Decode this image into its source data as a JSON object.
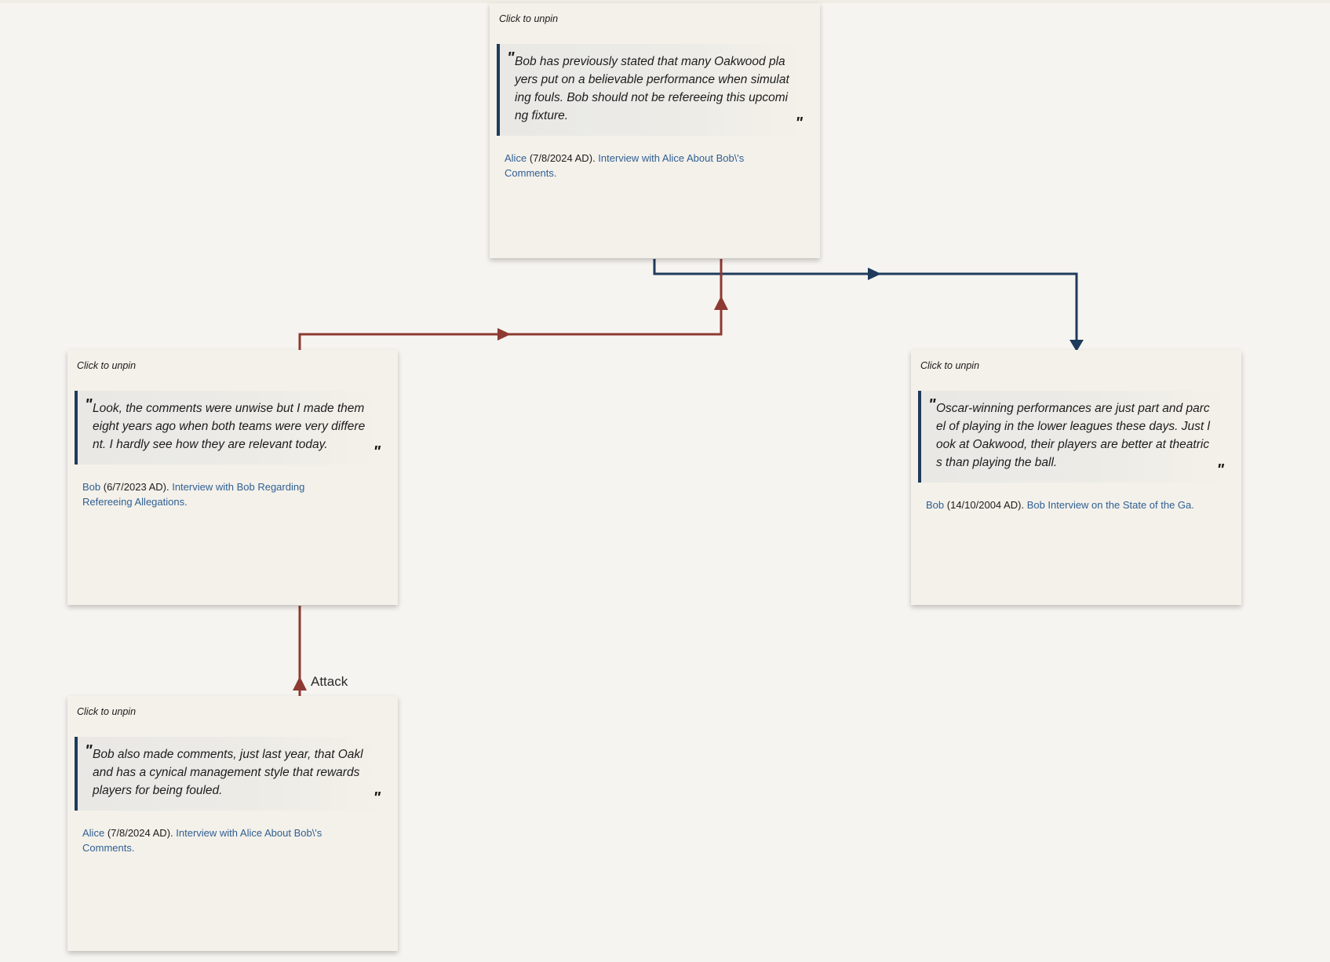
{
  "colors": {
    "support_edge": "#1f3b5c",
    "attack_edge": "#8e3a32",
    "card_background": "#f4f1ea",
    "link": "#2f5f93"
  },
  "cards": {
    "alice_top": {
      "unpin_label": "Click to unpin",
      "open_quote": "\"",
      "close_quote": "\"",
      "quote_text": "Bob has previously stated that many Oakwood players put on a believable performance when simulating fouls. Bob should not be refereeing this upcoming fixture.",
      "author": "Alice",
      "date": "(7/8/2024 AD).",
      "source": "Interview with Alice About Bob\\'s Comments."
    },
    "bob_left": {
      "unpin_label": "Click to unpin",
      "open_quote": "\"",
      "close_quote": "\"",
      "quote_text": "Look, the comments were unwise but I made them eight years ago when both teams were very different. I hardly see how they are relevant today.",
      "author": "Bob",
      "date": "(6/7/2023 AD).",
      "source": "Interview with Bob Regarding Refereeing Allegations."
    },
    "bob_right": {
      "unpin_label": "Click to unpin",
      "open_quote": "\"",
      "close_quote": "\"",
      "quote_text": "Oscar-winning performances are just part and parcel of playing in the lower leagues these days. Just look at Oakwood, their players are better at theatrics than playing the ball.",
      "author": "Bob",
      "date": "(14/10/2004 AD).",
      "source": "Bob Interview on the State of the Ga."
    },
    "alice_bottom": {
      "unpin_label": "Click to unpin",
      "open_quote": "\"",
      "close_quote": "\"",
      "quote_text": "Bob also made comments, just last year, that Oakland has a cynical management style that rewards players for being fouled.",
      "author": "Alice",
      "date": "(7/8/2024 AD).",
      "source": "Interview with Alice About Bob\\'s Comments."
    }
  },
  "edges": {
    "attack_label": "Attack"
  }
}
